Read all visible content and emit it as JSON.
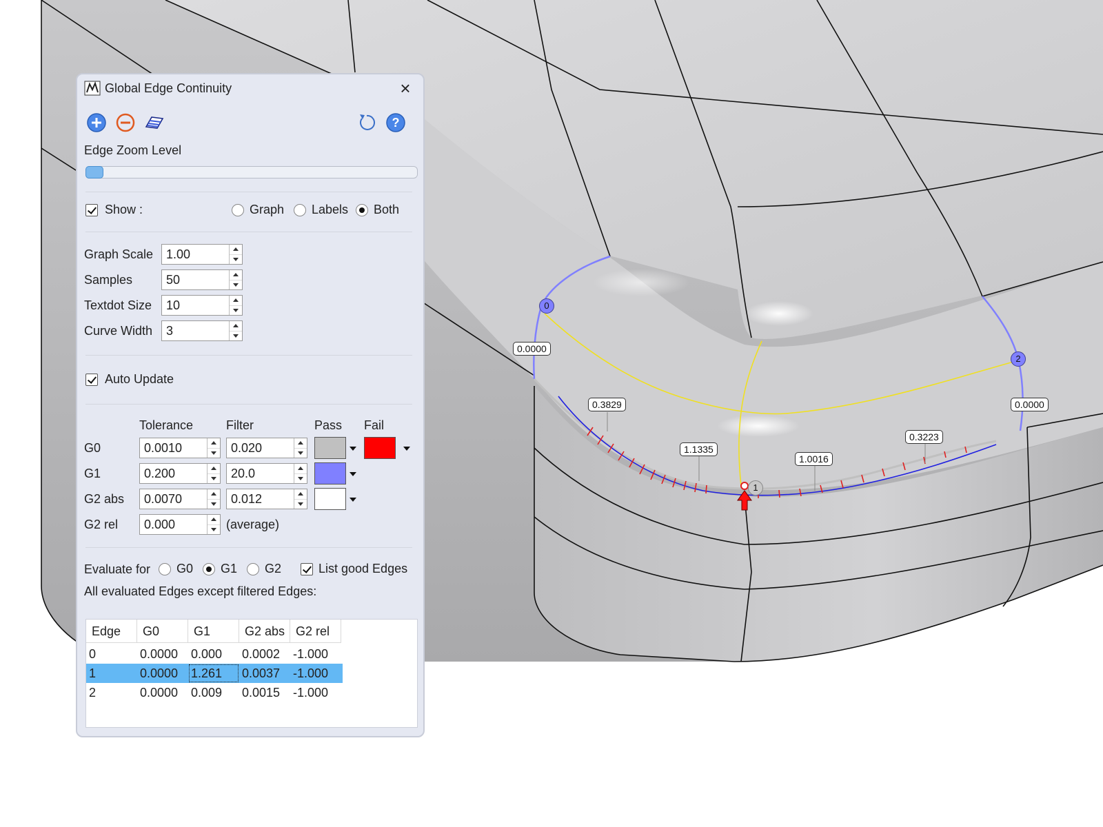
{
  "dialog": {
    "title": "Global Edge Continuity",
    "toolbar": {
      "add_icon": "plus-circle-icon",
      "remove_icon": "minus-circle-icon",
      "surface_icon": "surface-stripes-icon",
      "reset_icon": "rotate-ccw-icon",
      "help_icon": "help-circle-icon"
    },
    "zoom": {
      "label": "Edge Zoom Level",
      "value_fraction": 0.05
    },
    "show": {
      "label": "Show :",
      "checked": true,
      "options": [
        "Graph",
        "Labels",
        "Both"
      ],
      "selected": "Both"
    },
    "fields": [
      {
        "label": "Graph Scale",
        "value": "1.00"
      },
      {
        "label": "Samples",
        "value": "50"
      },
      {
        "label": "Textdot Size",
        "value": "10"
      },
      {
        "label": "Curve Width",
        "value": "3"
      }
    ],
    "auto_update": {
      "label": "Auto Update",
      "checked": true
    },
    "tolerance": {
      "headers": {
        "tolerance": "Tolerance",
        "filter": "Filter",
        "pass": "Pass",
        "fail": "Fail"
      },
      "rows": [
        {
          "label": "G0",
          "tolerance": "0.0010",
          "filter": "0.020",
          "pass_color": "#c0c0c0",
          "fail_color": "#ff0000"
        },
        {
          "label": "G1",
          "tolerance": "0.200",
          "filter": "20.0",
          "pass_color": "#8080ff"
        },
        {
          "label": "G2 abs",
          "tolerance": "0.0070",
          "filter": "0.012",
          "pass_color": "#ffffff"
        },
        {
          "label": "G2 rel",
          "tolerance": "0.000",
          "note": "(average)"
        }
      ]
    },
    "evaluate": {
      "label": "Evaluate for",
      "options": [
        "G0",
        "G1",
        "G2"
      ],
      "selected": "G1",
      "list_good": {
        "label": "List good Edges",
        "checked": true
      }
    },
    "edges_caption": "All evaluated Edges except filtered Edges:",
    "table": {
      "headers": [
        "Edge",
        "G0",
        "G1",
        "G2 abs",
        "G2 rel"
      ],
      "rows": [
        [
          "0",
          "0.0000",
          "0.000",
          "0.0002",
          "-1.000"
        ],
        [
          "1",
          "0.0000",
          "1.261",
          "0.0037",
          "-1.000"
        ],
        [
          "2",
          "0.0000",
          "0.009",
          "0.0015",
          "-1.000"
        ]
      ],
      "selected_row": 1
    }
  },
  "viewport": {
    "edge_markers": [
      "0",
      "1",
      "2"
    ],
    "labels": [
      "0.0000",
      "0.3829",
      "1.1335",
      "1.0016",
      "0.3223",
      "0.0000"
    ]
  }
}
